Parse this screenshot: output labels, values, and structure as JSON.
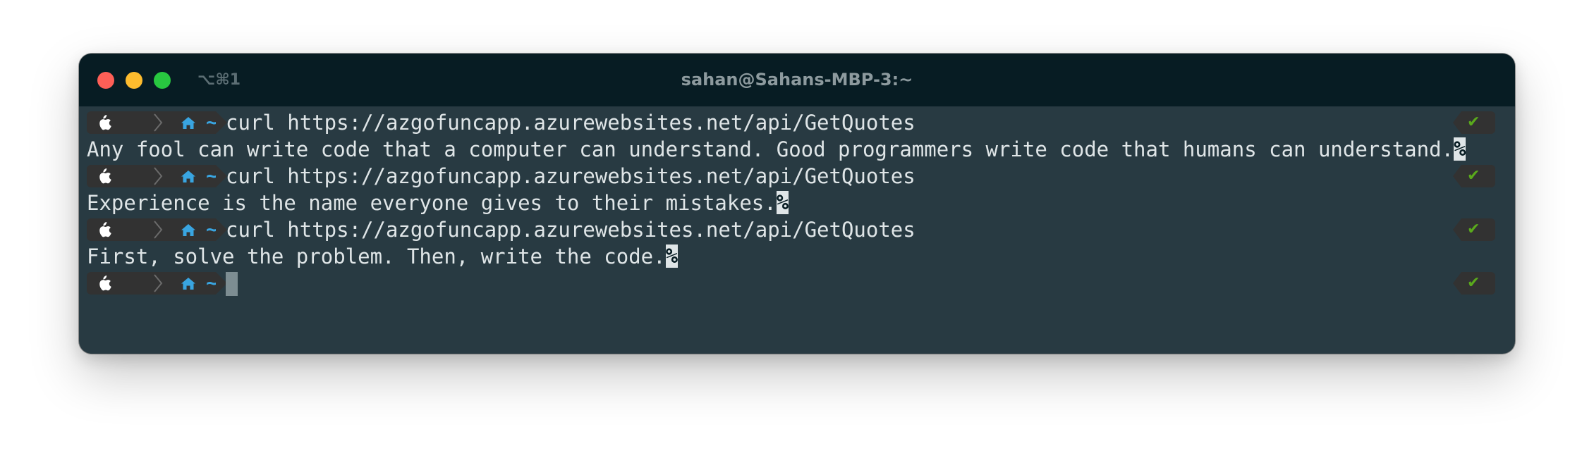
{
  "window": {
    "title": "sahan@Sahans-MBP-3:~",
    "shortcut": "⌥⌘1"
  },
  "colors": {
    "terminal_bg": "#283a42",
    "titlebar_bg": "#071c23",
    "text": "#dfe5e7",
    "prompt_segment_bg": "#323232",
    "dir_accent": "#39a5e1",
    "status_ok": "#5aaa1c"
  },
  "prompt": {
    "os_icon": "apple-icon",
    "dir_icon": "home-icon",
    "dir_text": "~",
    "status_symbol": "✔"
  },
  "session": [
    {
      "command": "curl https://azgofuncapp.azurewebsites.net/api/GetQuotes",
      "output": "Any fool can write code that a computer can understand. Good programmers write code that humans can understand.",
      "no_newline_marker": "%"
    },
    {
      "command": "curl https://azgofuncapp.azurewebsites.net/api/GetQuotes",
      "output": "Experience is the name everyone gives to their mistakes.",
      "no_newline_marker": "%"
    },
    {
      "command": "curl https://azgofuncapp.azurewebsites.net/api/GetQuotes",
      "output": "First, solve the problem. Then, write the code.",
      "no_newline_marker": "%"
    }
  ]
}
